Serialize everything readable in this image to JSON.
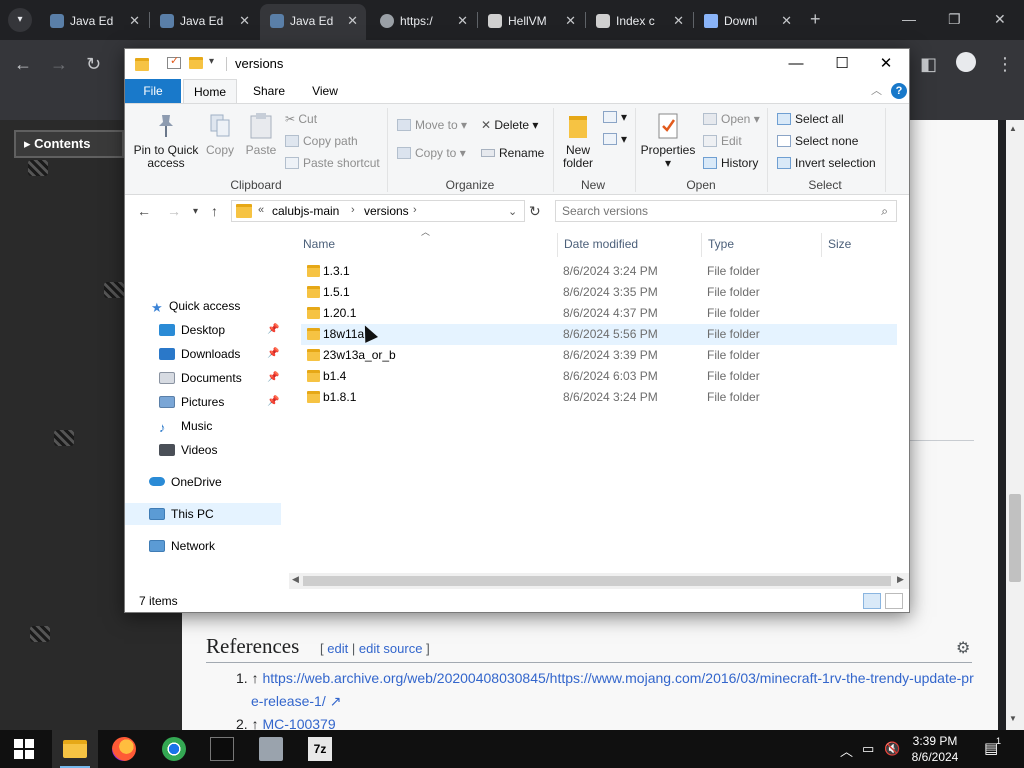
{
  "browser": {
    "tabs": [
      {
        "title": "Java Ed",
        "active": false,
        "color": "#5a7fa8"
      },
      {
        "title": "Java Ed",
        "active": false,
        "color": "#5a7fa8"
      },
      {
        "title": "Java Ed",
        "active": true,
        "color": "#5a7fa8"
      },
      {
        "title": "https:/",
        "active": false,
        "color": "#9aa0a6"
      },
      {
        "title": "HellVM",
        "active": false,
        "color": "#cfcfcf"
      },
      {
        "title": "Index c",
        "active": false,
        "color": "#cfcfcf"
      },
      {
        "title": "Downl",
        "active": false,
        "color": "#8ab4f8"
      }
    ],
    "tab_close_glyph": "✕",
    "new_tab_glyph": "+",
    "minimize_glyph": "—",
    "restore_glyph": "❐",
    "close_glyph": "✕"
  },
  "page": {
    "contents_label": "Contents",
    "references_heading": "References",
    "edit_open": "[",
    "edit_label": "edit",
    "edit_separator": "|",
    "edit_source_label": "edit source",
    "edit_close": "]",
    "ref1_marker": "1. ↑",
    "ref1_link": "https://web.archive.org/web/20200408030845/https://www.mojang.com/2016/03/minecraft-1rv-the-trendy-update-pr",
    "ref1_link_cont": "e-release-1/ ↗",
    "ref2_marker": "2. ↑",
    "ref2_link": "MC-100379"
  },
  "explorer": {
    "title": "versions",
    "window_controls": {
      "minimize": "—",
      "maximize": "☐",
      "close": "✕"
    },
    "ribbon_tabs": [
      "File",
      "Home",
      "Share",
      "View"
    ],
    "ribbon": {
      "clipboard": {
        "label": "Clipboard",
        "pin_line1": "Pin to Quick",
        "pin_line2": "access",
        "copy": "Copy",
        "paste": "Paste",
        "cut": "Cut",
        "copy_path": "Copy path",
        "paste_shortcut": "Paste shortcut"
      },
      "organize": {
        "label": "Organize",
        "move_to": "Move to",
        "copy_to": "Copy to",
        "delete": "Delete",
        "rename": "Rename"
      },
      "new": {
        "label": "New",
        "new_folder_line1": "New",
        "new_folder_line2": "folder"
      },
      "open": {
        "label": "Open",
        "properties": "Properties",
        "open": "Open",
        "edit": "Edit",
        "history": "History"
      },
      "select": {
        "label": "Select",
        "select_all": "Select all",
        "select_none": "Select none",
        "invert_selection": "Invert selection"
      }
    },
    "address": {
      "crumb_prefix": "«",
      "crumbs": [
        "calubjs-main",
        "versions"
      ],
      "separator": "›"
    },
    "search": {
      "placeholder": "Search versions"
    },
    "nav": {
      "quick_access": "Quick access",
      "desktop": "Desktop",
      "downloads": "Downloads",
      "documents": "Documents",
      "pictures": "Pictures",
      "music": "Music",
      "videos": "Videos",
      "onedrive": "OneDrive",
      "this_pc": "This PC",
      "network": "Network"
    },
    "columns": {
      "name": "Name",
      "date": "Date modified",
      "type": "Type",
      "size": "Size"
    },
    "files": [
      {
        "name": "1.3.1",
        "date": "8/6/2024 3:24 PM",
        "type": "File folder"
      },
      {
        "name": "1.5.1",
        "date": "8/6/2024 3:35 PM",
        "type": "File folder"
      },
      {
        "name": "1.20.1",
        "date": "8/6/2024 4:37 PM",
        "type": "File folder"
      },
      {
        "name": "18w11a",
        "date": "8/6/2024 5:56 PM",
        "type": "File folder"
      },
      {
        "name": "23w13a_or_b",
        "date": "8/6/2024 3:39 PM",
        "type": "File folder"
      },
      {
        "name": "b1.4",
        "date": "8/6/2024 6:03 PM",
        "type": "File folder"
      },
      {
        "name": "b1.8.1",
        "date": "8/6/2024 3:24 PM",
        "type": "File folder"
      }
    ],
    "status": "7 items"
  },
  "taskbar": {
    "time": "3:39 PM",
    "date": "8/6/2024",
    "notification_count": "1",
    "archiver_label": "7z"
  },
  "colors": {
    "accent": "#1979ca",
    "selection": "#e5f3ff",
    "folder": "#f6c343"
  }
}
